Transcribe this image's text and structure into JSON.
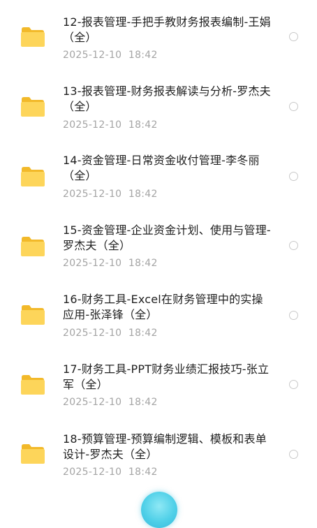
{
  "files": [
    {
      "name": "12-报表管理-手把手教财务报表编制-王娟（全）",
      "date": "2025-12-10  18:42",
      "icon": "folder-icon"
    },
    {
      "name": "13-报表管理-财务报表解读与分析-罗杰夫（全）",
      "date": "2025-12-10  18:42",
      "icon": "folder-icon"
    },
    {
      "name": "14-资金管理-日常资金收付管理-李冬丽（全）",
      "date": "2025-12-10  18:42",
      "icon": "folder-icon"
    },
    {
      "name": "15-资金管理-企业资金计划、使用与管理-罗杰夫（全）",
      "date": "2025-12-10  18:42",
      "icon": "folder-icon"
    },
    {
      "name": "16-财务工具-Excel在财务管理中的实操应用-张泽锋（全）",
      "date": "2025-12-10  18:42",
      "icon": "folder-icon"
    },
    {
      "name": "17-财务工具-PPT财务业绩汇报技巧-张立军（全）",
      "date": "2025-12-10  18:42",
      "icon": "folder-icon"
    },
    {
      "name": "18-预算管理-预算编制逻辑、模板和表单设计-罗杰夫（全）",
      "date": "2025-12-10  18:42",
      "icon": "folder-icon"
    }
  ],
  "colors": {
    "folder_back": "#f6c435",
    "folder_front": "#fdd85b",
    "title_text": "#1f1f1f",
    "date_text": "#a4a4a4",
    "radio_border": "#c9c9c9",
    "fab": "#4fd0e8"
  }
}
